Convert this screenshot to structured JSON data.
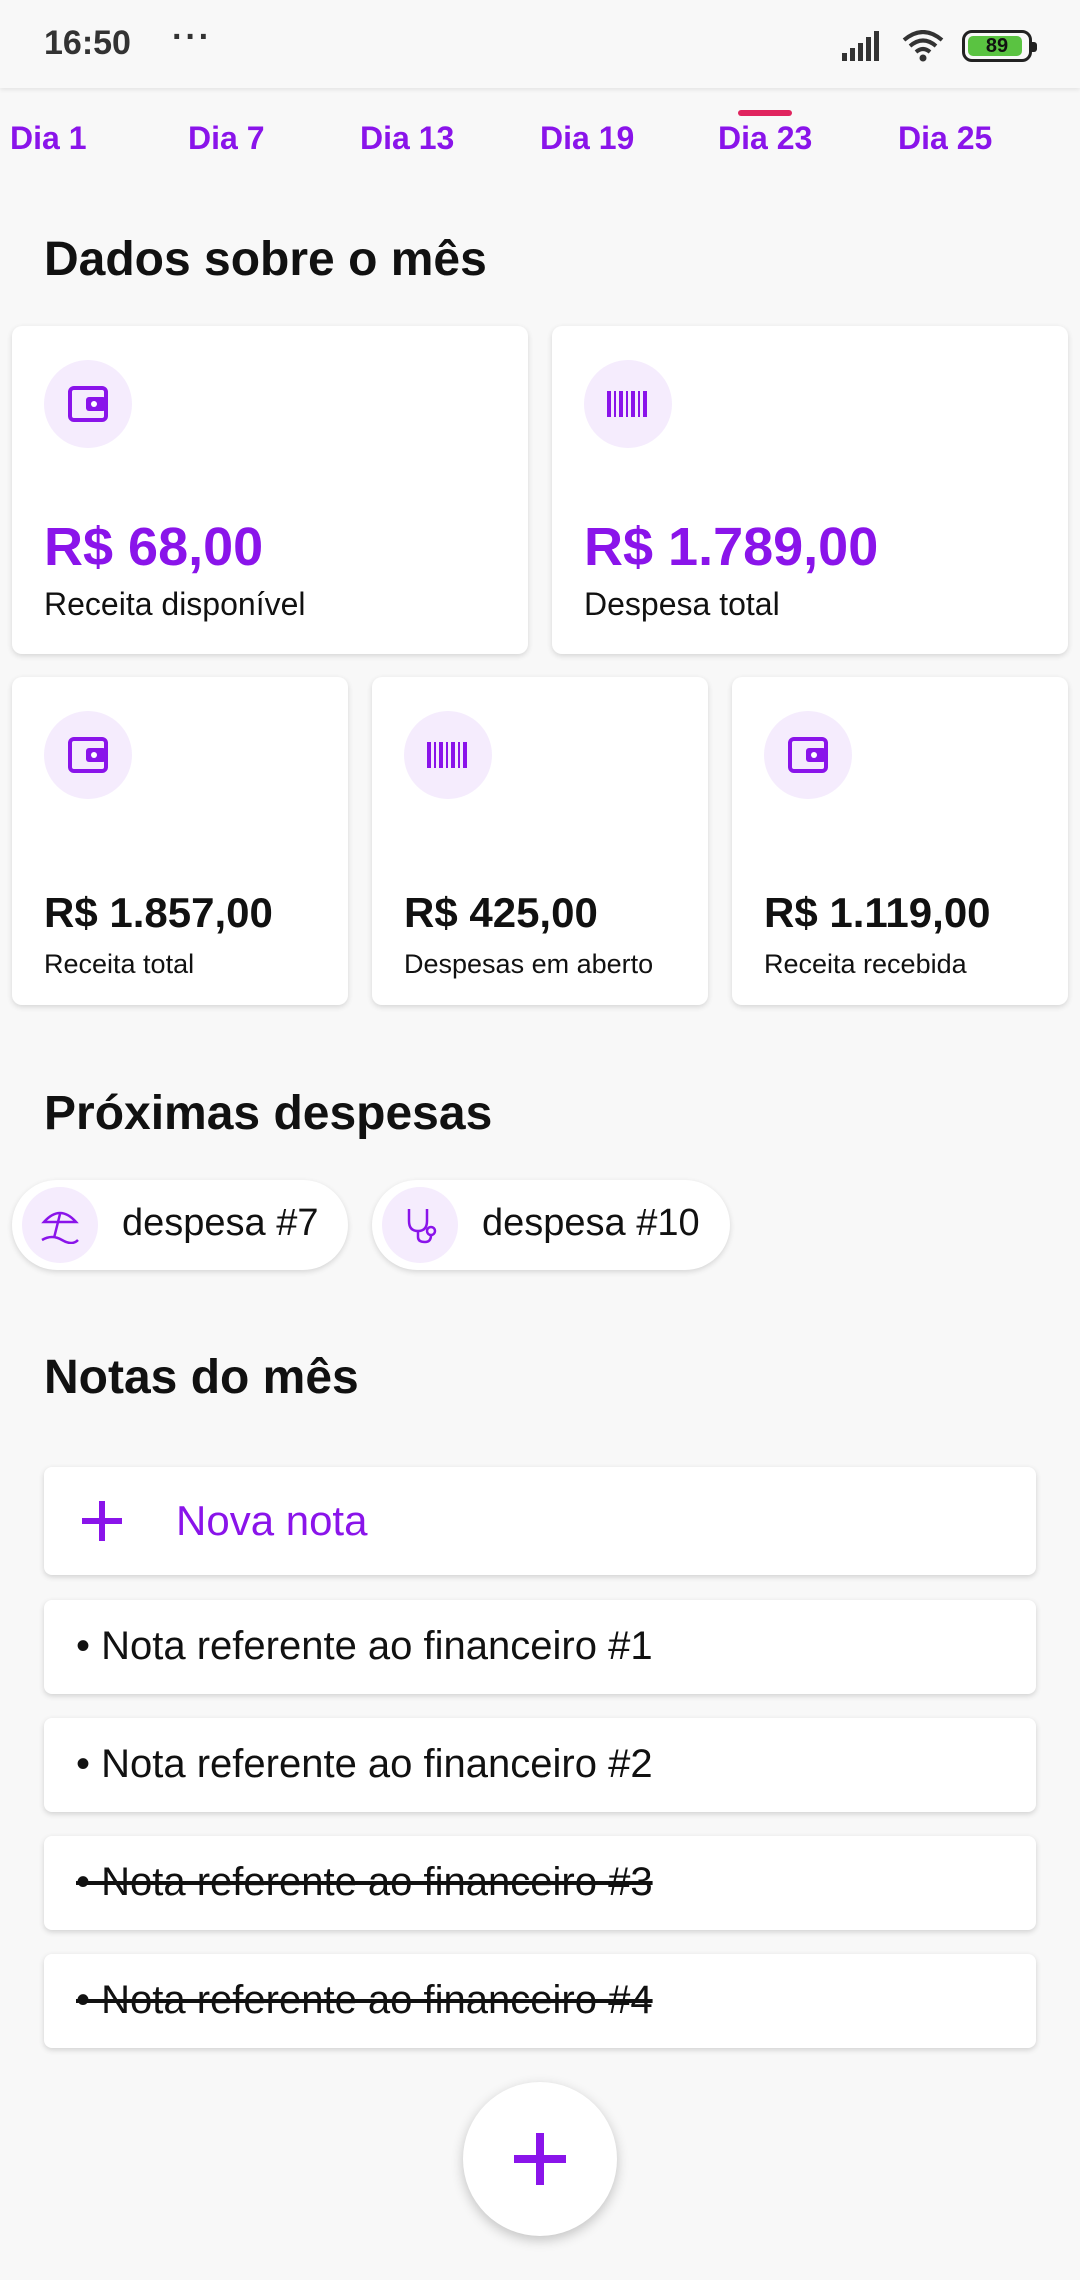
{
  "status_bar": {
    "time": "16:50",
    "more": "···",
    "battery": "89"
  },
  "tabs": [
    {
      "label": "Dia 1"
    },
    {
      "label": "Dia 7"
    },
    {
      "label": "Dia 13"
    },
    {
      "label": "Dia 19"
    },
    {
      "label": "Dia 23",
      "selected": true
    },
    {
      "label": "Dia 25"
    }
  ],
  "month_data": {
    "title": "Dados sobre o mês",
    "cards": [
      {
        "amount": "R$ 68,00",
        "label": "Receita disponível",
        "icon": "wallet-icon"
      },
      {
        "amount": "R$ 1.789,00",
        "label": "Despesa total",
        "icon": "barcode-icon"
      },
      {
        "amount": "R$ 1.857,00",
        "label": "Receita total",
        "icon": "wallet-icon"
      },
      {
        "amount": "R$ 425,00",
        "label": "Despesas em aberto",
        "icon": "barcode-icon"
      },
      {
        "amount": "R$ 1.119,00",
        "label": "Receita recebida",
        "icon": "wallet-icon"
      }
    ]
  },
  "upcoming": {
    "title": "Próximas despesas",
    "items": [
      {
        "label": "despesa #7",
        "icon": "beach-umbrella-icon"
      },
      {
        "label": "despesa #10",
        "icon": "stethoscope-icon"
      }
    ]
  },
  "notes": {
    "title": "Notas do mês",
    "new_note_label": "Nova nota",
    "items": [
      {
        "text": "• Nota referente ao financeiro #1",
        "done": false
      },
      {
        "text": "• Nota referente ao financeiro #2",
        "done": false
      },
      {
        "text": "• Nota referente ao financeiro #3",
        "done": true
      },
      {
        "text": "• Nota referente ao financeiro #4",
        "done": true
      }
    ]
  },
  "colors": {
    "accent": "#8a14ea",
    "indicator": "#e0245e",
    "icon_bg": "#f5ecfd",
    "battery": "#5ac341"
  }
}
